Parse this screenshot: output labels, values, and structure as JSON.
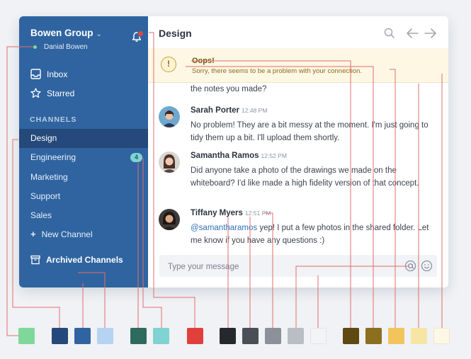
{
  "sidebar": {
    "workspace": "Bowen Group",
    "user": "Danial Bowen",
    "nav": [
      {
        "label": "Inbox",
        "icon": "inbox-icon"
      },
      {
        "label": "Starred",
        "icon": "star-icon"
      }
    ],
    "section_label": "CHANNELS",
    "channels": [
      {
        "label": "Design",
        "active": true
      },
      {
        "label": "Engineering",
        "badge": "4"
      },
      {
        "label": "Marketing"
      },
      {
        "label": "Support"
      },
      {
        "label": "Sales"
      }
    ],
    "new_channel": "New Channel",
    "archived": "Archived Channels"
  },
  "main": {
    "title": "Design",
    "alert": {
      "title": "Oops!",
      "text": "Sorry, there seems to be a problem with your connection."
    },
    "partial_message": "the notes you made?",
    "messages": [
      {
        "name": "Sarah Porter",
        "time": "12:48 PM",
        "body": "No problem! They are a bit messy at the moment. I'm just going to tidy them up a bit. I'll upload them shortly."
      },
      {
        "name": "Samantha Ramos",
        "time": "12:52 PM",
        "body": "Did anyone take a photo of the drawings we made on the whiteboard? I'd like made a high fidelity version of that concept."
      },
      {
        "name": "Tiffany Myers",
        "time": "12:51 PM",
        "mention": "@samantharamos",
        "body": " yep! I put a few photos in the shared folder. Let me know if you have any questions :)"
      }
    ],
    "composer_placeholder": "Type your message"
  },
  "palette": [
    {
      "color": "#7fd89a"
    },
    {
      "color": "#24497a"
    },
    {
      "color": "#2f64a0"
    },
    {
      "color": "#b7d3f2"
    },
    {
      "color": "#2f6a5e"
    },
    {
      "color": "#7fd3d2"
    },
    {
      "color": "#e0403c"
    },
    {
      "color": "#25282d"
    },
    {
      "color": "#4a4f57"
    },
    {
      "color": "#8b9099"
    },
    {
      "color": "#b9bdc4"
    },
    {
      "color": "#f3f4f6"
    },
    {
      "color": "#5f4912"
    },
    {
      "color": "#8c6e21"
    },
    {
      "color": "#f2c45c"
    },
    {
      "color": "#f7e5a6"
    },
    {
      "color": "#fdf8e6"
    }
  ]
}
